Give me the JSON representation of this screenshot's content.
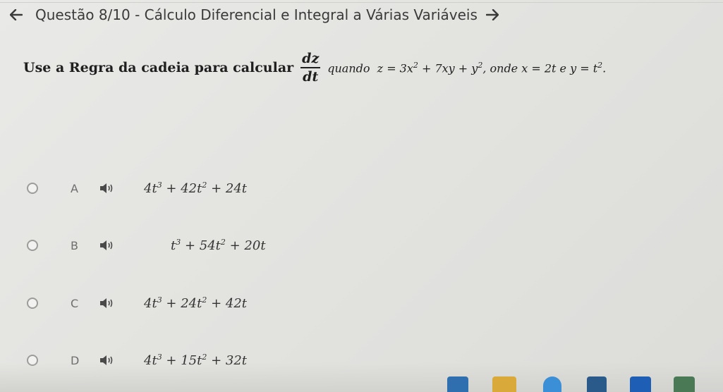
{
  "header": {
    "back_icon": "arrow-left-icon",
    "title": "Questão 8/10 - Cálculo Diferencial e Integral a Várias Variáveis",
    "forward_icon": "arrow-right-icon"
  },
  "question": {
    "prefix": "Use a Regra da cadeia para calcular",
    "frac_num": "dz",
    "frac_den": "dt",
    "quando": "quando",
    "eq_z": "z = 3x",
    "exp_z": "2",
    "eq_mid": " + 7xy + y",
    "exp_y": "2",
    "onde": ", onde x = 2t e y = t",
    "exp_t": "2",
    "end": "."
  },
  "options": [
    {
      "letter": "A",
      "c1": "4t",
      "e1": "3",
      "c2": " + 42t",
      "e2": "2",
      "c3": " + 24t"
    },
    {
      "letter": "B",
      "c1": "t",
      "e1": "3",
      "c2": " + 54t",
      "e2": "2",
      "c3": " + 20t"
    },
    {
      "letter": "C",
      "c1": "4t",
      "e1": "3",
      "c2": " + 24t",
      "e2": "2",
      "c3": " + 42t"
    },
    {
      "letter": "D",
      "c1": "4t",
      "e1": "3",
      "c2": " + 15t",
      "e2": "2",
      "c3": " + 32t"
    }
  ],
  "colors": {
    "background": "#e6e6e3",
    "text": "#2b2b2b",
    "radio_border": "#9c9c9a"
  },
  "icons": {
    "speaker": "speaker-icon"
  }
}
